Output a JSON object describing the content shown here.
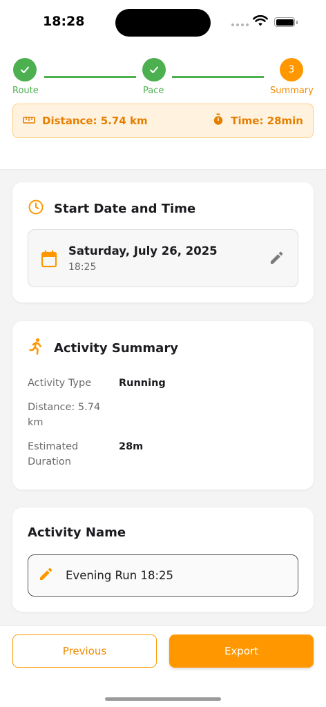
{
  "status_bar": {
    "time": "18:28"
  },
  "stepper": {
    "steps": [
      {
        "label": "Route",
        "state": "done"
      },
      {
        "label": "Pace",
        "state": "done"
      },
      {
        "label": "Summary",
        "state": "active",
        "number": "3"
      }
    ]
  },
  "info_bar": {
    "distance_icon": "ruler-icon",
    "distance": "Distance: 5.74 km",
    "time_icon": "stopwatch-icon",
    "time": "Time: 28min"
  },
  "start_card": {
    "icon": "clock-icon",
    "title": "Start Date and Time",
    "date": "Saturday, July 26, 2025",
    "time": "18:25",
    "calendar_icon": "calendar-icon",
    "edit_icon": "pencil-icon"
  },
  "summary_card": {
    "icon": "runner-icon",
    "title": "Activity Summary",
    "rows": [
      {
        "label": "Activity Type",
        "value": "Running"
      },
      {
        "label": "Distance: 5.74 km",
        "value": ""
      },
      {
        "label": "Estimated Duration",
        "value": "28m"
      }
    ]
  },
  "name_card": {
    "title": "Activity Name",
    "value": "Evening Run 18:25",
    "edit_icon": "pencil-icon"
  },
  "actions": {
    "previous": "Previous",
    "export": "Export"
  },
  "colors": {
    "accent": "#ff9800",
    "success": "#4caf50",
    "info_background": "#fff3e0"
  }
}
